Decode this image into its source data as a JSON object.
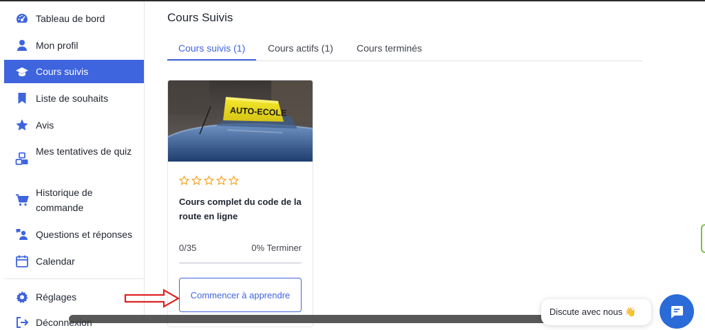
{
  "sidebar": {
    "items": [
      {
        "label": "Tableau de bord",
        "icon": "dashboard-gauge-icon"
      },
      {
        "label": "Mon profil",
        "icon": "user-icon"
      },
      {
        "label": "Cours suivis",
        "icon": "graduation-cap-icon",
        "active": true
      },
      {
        "label": "Liste de souhaits",
        "icon": "bookmark-icon"
      },
      {
        "label": "Avis",
        "icon": "star-icon"
      },
      {
        "label": "Mes tentatives de quiz",
        "icon": "quiz-blocks-icon"
      },
      {
        "label": "Historique de commande",
        "icon": "shopping-cart-icon"
      },
      {
        "label": "Questions et réponses",
        "icon": "question-answer-icon"
      },
      {
        "label": "Calendar",
        "icon": "calendar-icon"
      },
      {
        "label": "Réglages",
        "icon": "gear-icon"
      },
      {
        "label": "Déconnexion",
        "icon": "logout-icon"
      }
    ]
  },
  "main": {
    "title": "Cours Suivis",
    "tabs": [
      {
        "label": "Cours suivis (1)",
        "active": true
      },
      {
        "label": "Cours actifs (1)"
      },
      {
        "label": "Cours terminés"
      }
    ],
    "course_card": {
      "image_text": "AUTO-ECOLE",
      "rating_stars": 0,
      "rating_max": 5,
      "title": "Cours complet du code de la route en ligne",
      "progress_count": "0/35",
      "progress_percent_label": "0% Terminer",
      "progress_value": 0,
      "button_label": "Commencer à apprendre"
    }
  },
  "chat": {
    "bubble_text": "Discute avec nous 👋",
    "button_icon": "chat-icon"
  },
  "colors": {
    "accent": "#3e64de",
    "star": "#f5a623",
    "arrow": "#e02020",
    "chat_button": "#2a6bd8"
  }
}
